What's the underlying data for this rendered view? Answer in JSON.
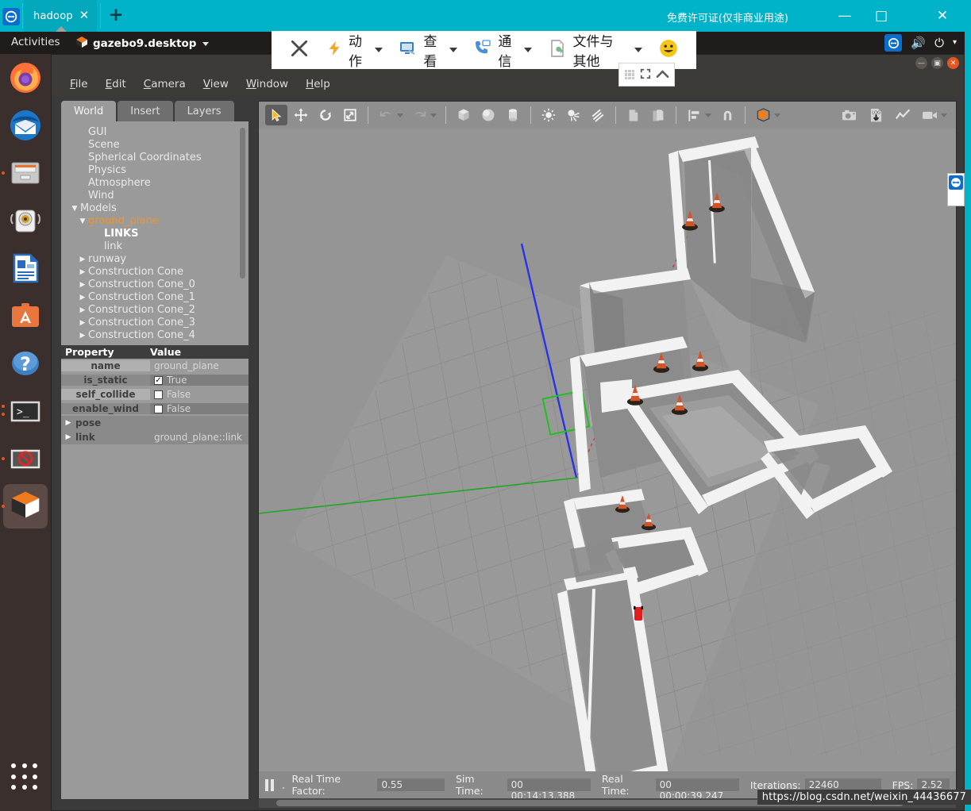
{
  "teamviewer": {
    "tab_label": "hadoop",
    "tab_close": "✕",
    "new_tab": "+",
    "license_text": "免费许可证(仅非商业用途)",
    "minimize": "—",
    "maximize": "□",
    "close": "✕",
    "logo_icon": "teamviewer-icon",
    "toolbar": [
      {
        "icon": "close-icon",
        "label": ""
      },
      {
        "icon": "lightning-icon",
        "label": "动作"
      },
      {
        "icon": "monitor-icon",
        "label": "查看"
      },
      {
        "icon": "phone-icon",
        "label": "通信"
      },
      {
        "icon": "file-icon",
        "label": "文件与其他"
      },
      {
        "icon": "smiley-icon",
        "label": ""
      }
    ],
    "float_widget": {
      "grid_icon": "grid-icon",
      "expand_icon": "expand-icon",
      "collapse_icon": "chevron-up-icon"
    },
    "side_tab_icon": "teamviewer-arrows-icon"
  },
  "gnome": {
    "activities": "Activities",
    "app_name": "gazebo9.desktop",
    "app_icon": "gazebo-icon",
    "tray": [
      "teamviewer-icon",
      "volume-icon",
      "power-icon",
      "chevron-down-icon"
    ]
  },
  "dock": {
    "items": [
      {
        "name": "firefox",
        "icon": "firefox-icon",
        "running": false,
        "active": false
      },
      {
        "name": "thunderbird",
        "icon": "thunderbird-icon",
        "running": false,
        "active": false
      },
      {
        "name": "files",
        "icon": "files-icon",
        "running": true,
        "active": false
      },
      {
        "name": "rhythmbox",
        "icon": "rhythmbox-icon",
        "running": false,
        "active": false
      },
      {
        "name": "libreoffice-writer",
        "icon": "libreoffice-writer-icon",
        "running": false,
        "active": false
      },
      {
        "name": "ubuntu-software",
        "icon": "ubuntu-software-icon",
        "running": false,
        "active": false
      },
      {
        "name": "help",
        "icon": "help-icon",
        "running": false,
        "active": false
      },
      {
        "name": "terminal",
        "icon": "terminal-icon",
        "running": true,
        "active": false
      },
      {
        "name": "no-entry",
        "icon": "no-entry-icon",
        "running": true,
        "active": false
      },
      {
        "name": "gazebo",
        "icon": "gazebo-icon",
        "running": true,
        "active": true
      }
    ],
    "show_apps": "show-applications-icon"
  },
  "gazebo": {
    "window_buttons": {
      "minimize": "—",
      "maximize": "▣",
      "close": "✕"
    },
    "menus": [
      "File",
      "Edit",
      "Camera",
      "View",
      "Window",
      "Help"
    ],
    "tabs": [
      {
        "label": "World",
        "active": true
      },
      {
        "label": "Insert",
        "active": false
      },
      {
        "label": "Layers",
        "active": false
      }
    ],
    "tree": [
      {
        "label": "GUI",
        "indent": 1,
        "twisty": "",
        "style": ""
      },
      {
        "label": "Scene",
        "indent": 1,
        "twisty": "",
        "style": ""
      },
      {
        "label": "Spherical Coordinates",
        "indent": 1,
        "twisty": "",
        "style": ""
      },
      {
        "label": "Physics",
        "indent": 1,
        "twisty": "",
        "style": ""
      },
      {
        "label": "Atmosphere",
        "indent": 1,
        "twisty": "",
        "style": ""
      },
      {
        "label": "Wind",
        "indent": 1,
        "twisty": "",
        "style": ""
      },
      {
        "label": "Models",
        "indent": 0,
        "twisty": "▼",
        "style": ""
      },
      {
        "label": "ground_plane",
        "indent": 1,
        "twisty": "▼",
        "style": "selected"
      },
      {
        "label": "LINKS",
        "indent": 3,
        "twisty": "",
        "style": "bold"
      },
      {
        "label": "link",
        "indent": 3,
        "twisty": "",
        "style": ""
      },
      {
        "label": "runway",
        "indent": 1,
        "twisty": "▶",
        "style": ""
      },
      {
        "label": "Construction Cone",
        "indent": 1,
        "twisty": "▶",
        "style": ""
      },
      {
        "label": "Construction Cone_0",
        "indent": 1,
        "twisty": "▶",
        "style": ""
      },
      {
        "label": "Construction Cone_1",
        "indent": 1,
        "twisty": "▶",
        "style": ""
      },
      {
        "label": "Construction Cone_2",
        "indent": 1,
        "twisty": "▶",
        "style": ""
      },
      {
        "label": "Construction Cone_3",
        "indent": 1,
        "twisty": "▶",
        "style": ""
      },
      {
        "label": "Construction Cone_4",
        "indent": 1,
        "twisty": "▶",
        "style": ""
      }
    ],
    "property_table": {
      "headers": [
        "Property",
        "Value"
      ],
      "rows": [
        {
          "key": "name",
          "value": "ground_plane",
          "type": "text"
        },
        {
          "key": "is_static",
          "value": "True",
          "type": "checkbox",
          "checked": true
        },
        {
          "key": "self_collide",
          "value": "False",
          "type": "checkbox",
          "checked": false
        },
        {
          "key": "enable_wind",
          "value": "False",
          "type": "checkbox",
          "checked": false
        }
      ],
      "expandables": [
        {
          "key": "pose",
          "value": ""
        },
        {
          "key": "link",
          "value": "ground_plane::link"
        }
      ]
    },
    "render_toolbar": [
      {
        "icon": "select-arrow-icon",
        "active": true
      },
      {
        "icon": "translate-icon",
        "active": false
      },
      {
        "icon": "rotate-icon",
        "active": false
      },
      {
        "icon": "scale-icon",
        "active": false
      },
      {
        "icon": "undo-icon",
        "active": false,
        "caret": true
      },
      {
        "icon": "redo-icon",
        "active": false,
        "caret": true
      },
      {
        "icon": "box-icon",
        "active": false
      },
      {
        "icon": "sphere-icon",
        "active": false
      },
      {
        "icon": "cylinder-icon",
        "active": false
      },
      {
        "icon": "point-light-icon",
        "active": false
      },
      {
        "icon": "spot-light-icon",
        "active": false
      },
      {
        "icon": "directional-light-icon",
        "active": false
      },
      {
        "icon": "copy-icon",
        "active": false
      },
      {
        "icon": "paste-icon",
        "active": false
      },
      {
        "icon": "align-icon",
        "active": false,
        "caret": true
      },
      {
        "icon": "snap-icon",
        "active": false
      },
      {
        "icon": "view-angle-icon",
        "active": false,
        "caret": true
      }
    ],
    "render_toolbar_right": [
      {
        "icon": "screenshot-icon"
      },
      {
        "icon": "log-record-icon"
      },
      {
        "icon": "plot-icon"
      },
      {
        "icon": "video-record-icon",
        "caret": true
      }
    ],
    "status": {
      "pause_icon": "pause-icon",
      "step_icon": "step-icon",
      "real_time_factor_label": "Real Time Factor:",
      "real_time_factor_value": "0.55",
      "sim_time_label": "Sim Time:",
      "sim_time_value": "00 00:14:13.388",
      "real_time_label": "Real Time:",
      "real_time_value": "00 00:00:39.247",
      "iterations_label": "Iterations:",
      "iterations_value": "22460",
      "fps_label": "FPS:",
      "fps_value": "2.52"
    }
  },
  "watermark": "https://blog.csdn.net/weixin_44436677",
  "colors": {
    "teamviewer_teal": "#00b3c8",
    "teamviewer_blue": "#0b6ecd",
    "ubuntu_orange": "#e95420",
    "dock_bg": "#3b2f2d",
    "gazebo_panel": "#9a9a9a",
    "scene_bg": "#959595",
    "selected_tree": "#f0952b"
  }
}
